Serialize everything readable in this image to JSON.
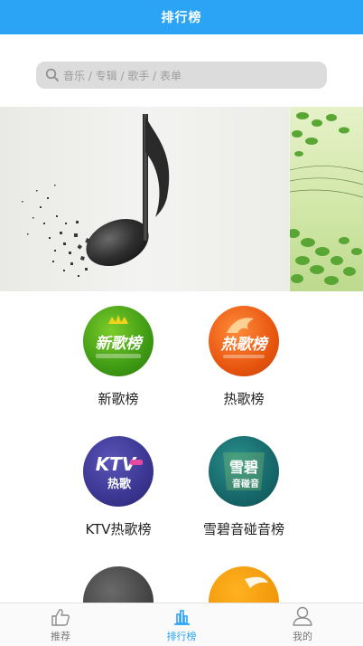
{
  "header": {
    "title": "排行榜"
  },
  "search": {
    "placeholder": "音乐 / 专辑 / 歌手 / 表单"
  },
  "charts": [
    {
      "label": "新歌榜"
    },
    {
      "label": "热歌榜"
    },
    {
      "label": "KTV热歌榜"
    },
    {
      "label": "雪碧音碰音榜"
    }
  ],
  "badges": {
    "new": "新歌榜",
    "hot": "热歌榜",
    "ktv": "KTV",
    "ktv_sub": "热歌",
    "sprite": "雪碧",
    "sprite_sub": "音碰音"
  },
  "tabs": [
    {
      "label": "推荐",
      "icon": "thumbs-up-icon"
    },
    {
      "label": "排行榜",
      "icon": "bar-chart-icon",
      "active": true
    },
    {
      "label": "我的",
      "icon": "user-icon"
    }
  ],
  "colors": {
    "accent": "#2ba4f5",
    "search_bg": "#dcdcdc"
  }
}
